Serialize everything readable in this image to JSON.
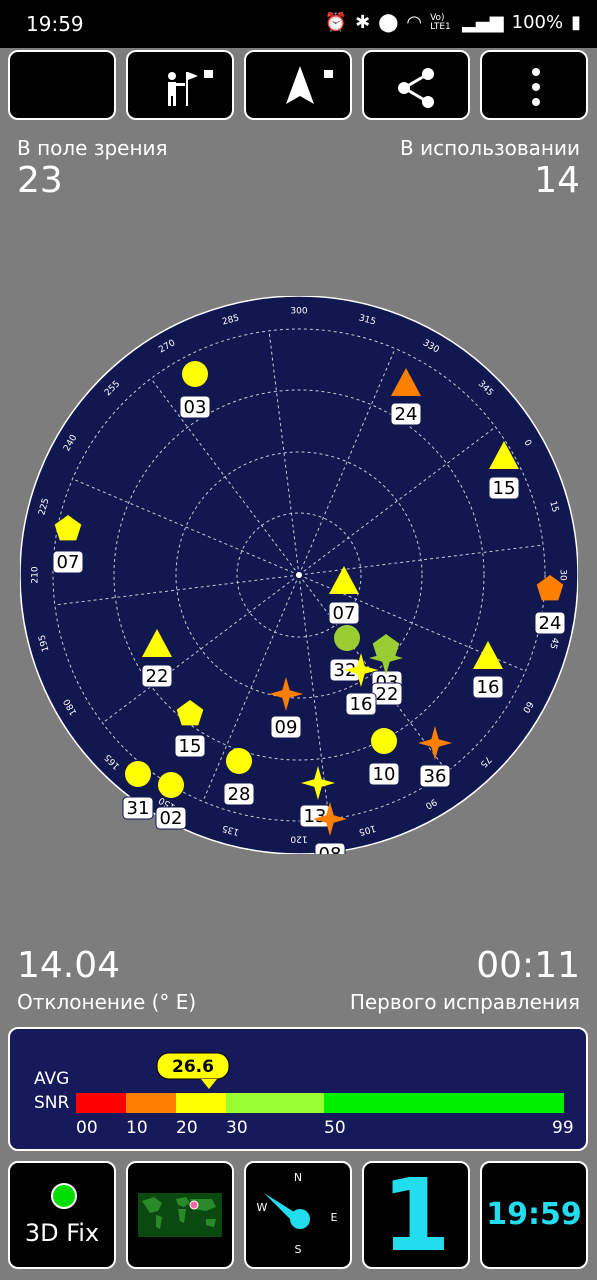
{
  "status_bar": {
    "time": "19:59",
    "battery": "100%",
    "network_label": "Vo) LTE1"
  },
  "toolbar": {
    "buttons": [
      {
        "icon": "night-mode-icon"
      },
      {
        "icon": "man-flag-icon"
      },
      {
        "icon": "navigation-arrow-icon"
      },
      {
        "icon": "share-icon"
      },
      {
        "icon": "more-menu-icon"
      }
    ]
  },
  "stats": {
    "in_view_label": "В поле зрения",
    "in_view_value": "23",
    "in_use_label": "В использовании",
    "in_use_value": "14",
    "declination_value": "14.04",
    "declination_label": "Отклонение (° E)",
    "first_fix_value": "00:11",
    "first_fix_label": "Первого исправления"
  },
  "sky_plot": {
    "degree_labels": [
      "300",
      "315",
      "330",
      "345",
      "0",
      "15",
      "30",
      "45",
      "60",
      "75",
      "90",
      "105",
      "120",
      "135",
      "150",
      "165",
      "180",
      "195",
      "210",
      "225",
      "240",
      "255",
      "270",
      "285"
    ],
    "satellites": [
      {
        "id": "03",
        "shape": "circle",
        "color": "#ffff00"
      },
      {
        "id": "24",
        "shape": "triangle",
        "color": "#ff7f00"
      },
      {
        "id": "15",
        "shape": "triangle",
        "color": "#ffff00"
      },
      {
        "id": "07",
        "shape": "pentagon",
        "color": "#ffff00"
      },
      {
        "id": "24",
        "shape": "pentagon",
        "color": "#ff7f00"
      },
      {
        "id": "07",
        "shape": "triangle",
        "color": "#ffff00"
      },
      {
        "id": "32",
        "shape": "circle",
        "color": "#9acd32"
      },
      {
        "id": "03",
        "shape": "pentagon",
        "color": "#9acd32"
      },
      {
        "id": "22",
        "shape": "star",
        "color": "#9acd32"
      },
      {
        "id": "16",
        "shape": "star",
        "color": "#ffff00"
      },
      {
        "id": "16",
        "shape": "triangle",
        "color": "#ffff00"
      },
      {
        "id": "22",
        "shape": "triangle",
        "color": "#ffff00"
      },
      {
        "id": "09",
        "shape": "star",
        "color": "#ff7f00"
      },
      {
        "id": "15",
        "shape": "pentagon",
        "color": "#ffff00"
      },
      {
        "id": "10",
        "shape": "circle",
        "color": "#ffff00"
      },
      {
        "id": "36",
        "shape": "star",
        "color": "#ff7f00"
      },
      {
        "id": "28",
        "shape": "circle",
        "color": "#ffff00"
      },
      {
        "id": "31",
        "shape": "circle",
        "color": "#ffff00"
      },
      {
        "id": "02",
        "shape": "circle",
        "color": "#ffff00"
      },
      {
        "id": "13",
        "shape": "star",
        "color": "#ffff00"
      },
      {
        "id": "08",
        "shape": "star",
        "color": "#ff7f00"
      }
    ]
  },
  "snr": {
    "avg_label": "AVG",
    "snr_label": "SNR",
    "avg_value": "26.6",
    "ticks": [
      "00",
      "10",
      "20",
      "30",
      "50",
      "99"
    ],
    "segments": [
      {
        "from": 0,
        "to": 10,
        "color": "#ff0000"
      },
      {
        "from": 10,
        "to": 20,
        "color": "#ff8000"
      },
      {
        "from": 20,
        "to": 30,
        "color": "#ffff00"
      },
      {
        "from": 30,
        "to": 50,
        "color": "#99ff33"
      },
      {
        "from": 50,
        "to": 99,
        "color": "#00ee00"
      }
    ]
  },
  "bottom": {
    "fix_label": "3D Fix",
    "fix_color": "#00dd00",
    "compass_labels": [
      "N",
      "E",
      "S",
      "W"
    ],
    "satellite_count": "1",
    "clock": "19:59",
    "accent": "#22ddee"
  }
}
